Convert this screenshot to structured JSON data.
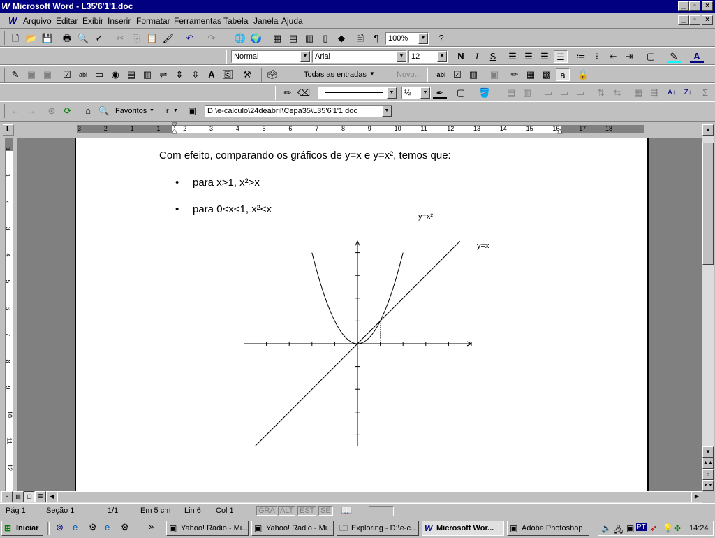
{
  "window": {
    "title": "Microsoft Word - L35'6'1'1.doc"
  },
  "menu": [
    "Arquivo",
    "Editar",
    "Exibir",
    "Inserir",
    "Formatar",
    "Ferramentas",
    "Tabela",
    "Janela",
    "Ajuda"
  ],
  "toolbar": {
    "zoom": "100%",
    "style": "Normal",
    "font": "Arial",
    "size": "12",
    "form_field": "Todas as entradas",
    "new_label": "Novo...",
    "line_weight": "½"
  },
  "web": {
    "favorites": "Favoritos",
    "go": "Ir",
    "address": "D:\\e-calculo\\24deabril\\Cepa35\\L35'6'1'1.doc"
  },
  "ruler_labels": [
    "3",
    "2",
    "1",
    "1",
    "2",
    "3",
    "4",
    "5",
    "6",
    "7",
    "8",
    "9",
    "10",
    "11",
    "12",
    "13",
    "14",
    "15",
    "16",
    "17",
    "18"
  ],
  "vruler_labels": [
    "1",
    "1",
    "2",
    "3",
    "4",
    "5",
    "6",
    "7",
    "8",
    "9",
    "10",
    "11",
    "12"
  ],
  "document": {
    "intro": "Com efeito, comparando os gráficos de y=x e y=x², temos que:",
    "bullets": [
      "para x>1, x²>x",
      "para 0<x<1, x²<x"
    ],
    "label_parabola": "y=x²",
    "label_line": "y=x"
  },
  "chart_data": {
    "type": "line",
    "series": [
      {
        "name": "y=x²",
        "x": [
          -2.0,
          -1.5,
          -1.0,
          -0.5,
          0,
          0.5,
          1.0,
          1.5,
          2.0
        ],
        "y": [
          4.0,
          2.25,
          1.0,
          0.25,
          0,
          0.25,
          1.0,
          2.25,
          4.0
        ]
      },
      {
        "name": "y=x",
        "x": [
          -4.5,
          4.5
        ],
        "y": [
          -4.5,
          4.5
        ]
      }
    ],
    "xlim": [
      -5,
      5
    ],
    "ylim": [
      -4.5,
      4.5
    ],
    "marked_point": {
      "x": 1,
      "y": 1
    }
  },
  "status": {
    "page": "Pág 1",
    "section": "Seção 1",
    "pages": "1/1",
    "at": "Em 5 cm",
    "line": "Lin 6",
    "col": "Col 1",
    "modes": [
      "GRA",
      "ALT",
      "EST",
      "SE"
    ]
  },
  "taskbar": {
    "start": "Iniciar",
    "tasks": [
      "Yahoo! Radio - Mi...",
      "Yahoo! Radio - Mi...",
      "Exploring - D:\\e-c...",
      "Microsoft Wor...",
      "Adobe Photoshop"
    ],
    "tray_lang": "PT",
    "clock": "14:24"
  }
}
